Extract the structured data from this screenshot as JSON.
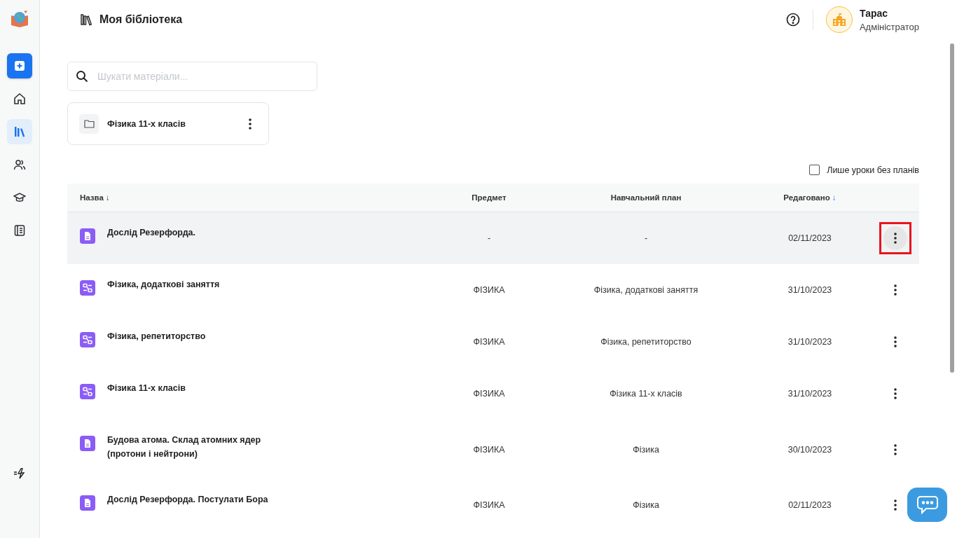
{
  "sidebar": {
    "items": [
      {
        "kind": "home",
        "selected": false
      },
      {
        "kind": "library",
        "selected": true
      },
      {
        "kind": "people",
        "selected": false
      },
      {
        "kind": "cap",
        "selected": false
      },
      {
        "kind": "notebook",
        "selected": false
      }
    ]
  },
  "header": {
    "title": "Моя бібліотека",
    "user": {
      "name": "Тарас",
      "role": "Адміністратор"
    }
  },
  "search": {
    "placeholder": "Шукати матеріали..."
  },
  "folders": [
    {
      "name": "Фізика 11-х класів"
    }
  ],
  "filter": {
    "label": "Лише уроки без планів",
    "checked": false
  },
  "table": {
    "columns": [
      {
        "label": "Назва",
        "sort": "↓",
        "active": false
      },
      {
        "label": "Предмет"
      },
      {
        "label": "Навчальний план"
      },
      {
        "label": "Редаговано",
        "sort": "↓",
        "active": true
      }
    ],
    "rows": [
      {
        "kind": "lesson",
        "name": "Дослід Резерфорда.",
        "subject": "-",
        "plan": "-",
        "edited": "02/11/2023",
        "selected": true,
        "highlighted": true
      },
      {
        "kind": "plan",
        "name": "Фізика, додаткові заняття",
        "subject": "ФІЗИКА",
        "plan": "Фізика, додаткові заняття",
        "edited": "31/10/2023",
        "selected": false,
        "highlighted": false
      },
      {
        "kind": "plan",
        "name": "Фізика, репетиторство",
        "subject": "ФІЗИКА",
        "plan": "Фізика, репетиторство",
        "edited": "31/10/2023",
        "selected": false,
        "highlighted": false
      },
      {
        "kind": "plan",
        "name": "Фізика 11-х класів",
        "subject": "ФІЗИКА",
        "plan": "Фізика 11-х класів",
        "edited": "31/10/2023",
        "selected": false,
        "highlighted": false
      },
      {
        "kind": "lesson",
        "name": "Будова атома. Склад атомних ядер (протони і нейтрони)",
        "subject": "ФІЗИКА",
        "plan": "Фізика",
        "edited": "30/10/2023",
        "selected": false,
        "highlighted": false
      },
      {
        "kind": "lesson",
        "name": "Дослід Резерфорда. Постулати Бора",
        "subject": "ФІЗИКА",
        "plan": "Фізика",
        "edited": "02/11/2023",
        "selected": false,
        "highlighted": false
      }
    ]
  }
}
